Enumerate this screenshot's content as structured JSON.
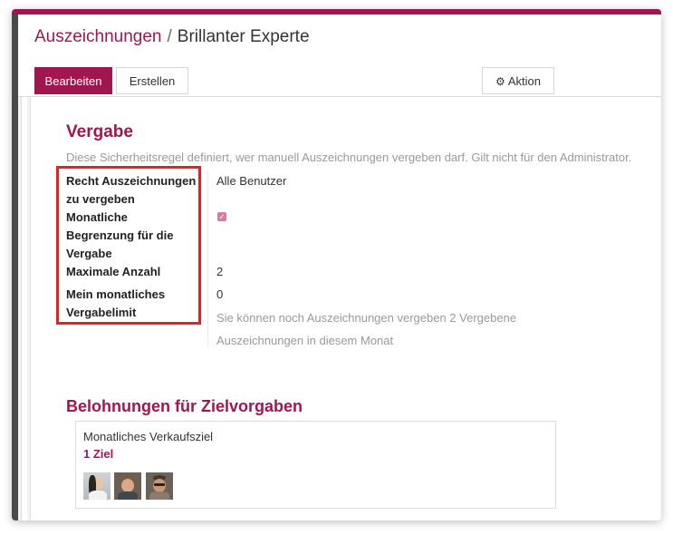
{
  "breadcrumb": {
    "parent": "Auszeichnungen",
    "separator": "/",
    "current": "Brillanter Experte"
  },
  "toolbar": {
    "edit_label": "Bearbeiten",
    "create_label": "Erstellen",
    "action_label": "Aktion",
    "action_icon": "gear-icon"
  },
  "section_vergabe": {
    "title": "Vergabe",
    "description": "Diese Sicherheitsregel definiert, wer manuell Auszeichnungen vergeben darf. Gilt nicht für den Administrator.",
    "fields": {
      "right_label_line1": "Recht Auszeichnungen",
      "right_label_line2": "zu vergeben",
      "right_value": "Alle Benutzer",
      "monthly_limit_label_line1": "Monatliche",
      "monthly_limit_label_line2": "Begrenzung für die",
      "monthly_limit_label_line3": "Vergabe",
      "monthly_limit_checked": true,
      "max_label": "Maximale Anzahl",
      "max_value": "2",
      "my_limit_label_line1": "Mein monatliches",
      "my_limit_label_line2": "Vergabelimit",
      "my_limit_value": "0",
      "my_limit_note_line1": "Sie können noch Auszeichnungen vergeben 2 Vergebene",
      "my_limit_note_line2": "Auszeichnungen in diesem Monat"
    }
  },
  "section_rewards": {
    "title": "Belohnungen für Zielvorgaben",
    "cards": [
      {
        "name": "Monatliches Verkaufsziel",
        "count": "1 Ziel",
        "avatars": [
          "avatar",
          "avatar",
          "avatar"
        ]
      }
    ]
  },
  "colors": {
    "brand": "#a0174f",
    "highlight": "#e02424",
    "muted_text": "#9a9a9a"
  }
}
